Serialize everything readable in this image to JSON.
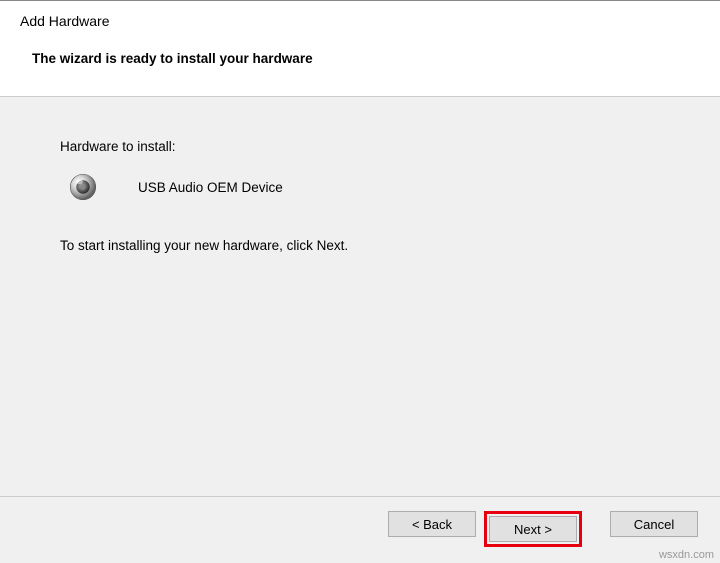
{
  "window": {
    "title": "Add Hardware",
    "subtitle": "The wizard is ready to install your hardware"
  },
  "content": {
    "install_label": "Hardware to install:",
    "device_name": "USB Audio OEM Device",
    "instruction": "To start installing your new hardware, click Next."
  },
  "footer": {
    "back_label": "< Back",
    "next_label": "Next >",
    "cancel_label": "Cancel"
  },
  "watermark": "wsxdn.com"
}
